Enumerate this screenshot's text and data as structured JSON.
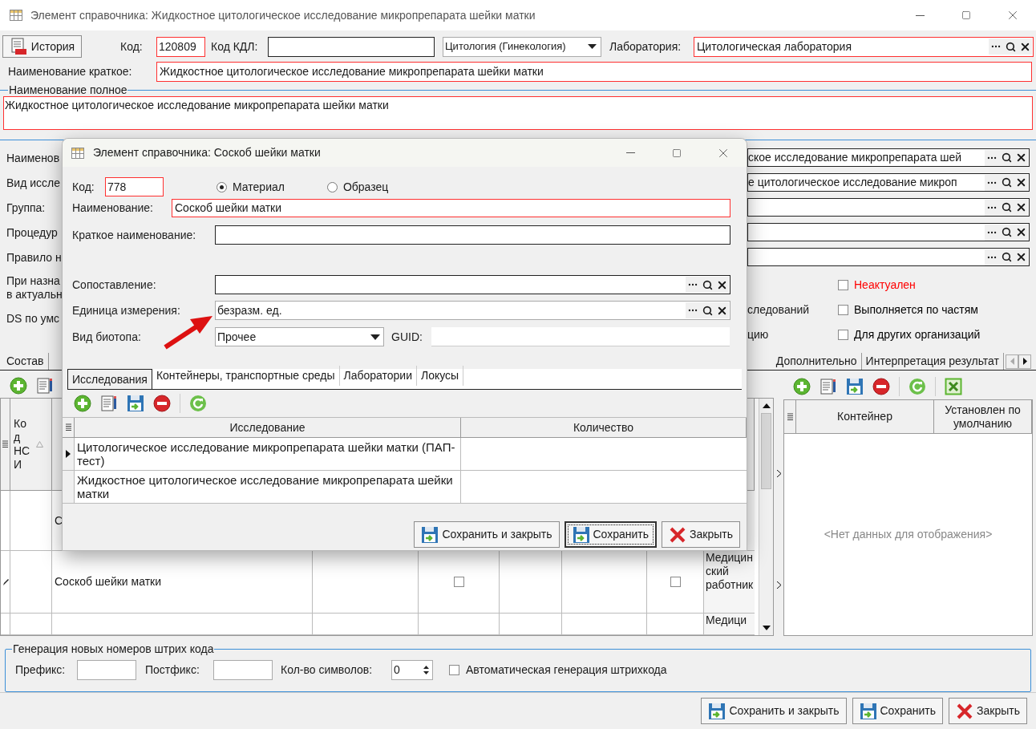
{
  "window": {
    "title": "Элемент справочника: Жидкостное цитологическое исследование микропрепарата шейки матки"
  },
  "history_button": "История",
  "code": {
    "label": "Код:",
    "value": "120809",
    "required": true
  },
  "kdl_code": {
    "label": "Код КДЛ:",
    "required": false
  },
  "category": {
    "value": "Цитология (Гинекология)"
  },
  "laboratory": {
    "label": "Лаборатория:",
    "value": "Цитологическая лаборатория",
    "required": true
  },
  "short_name": {
    "label": "Наименование краткое:",
    "value": "Жидкостное цитологическое исследование микропрепарата шейки матки",
    "required": true
  },
  "full_name": {
    "label": "Наименование полное",
    "value": "Жидкостное цитологическое исследование микропрепарата шейки матки",
    "required": true
  },
  "left_labels": [
    "Наименов",
    "Вид иссле",
    "Группа:",
    "Процедур",
    "Правило н",
    "При назна\nв актуальн",
    "DS по умс"
  ],
  "right_fields": [
    {
      "kind": "lookup",
      "value": "ское исследование микропрепарата шей"
    },
    {
      "kind": "lookup",
      "value": "е цитологическое исследование микроп"
    },
    {
      "kind": "lookup"
    },
    {
      "kind": "lookup"
    },
    {
      "kind": "lookup"
    }
  ],
  "flags": [
    {
      "label": "Неактуален",
      "checked": false,
      "color": "#ff0000"
    },
    {
      "fragment": "следований",
      "label": "Выполняется по частям",
      "checked": false,
      "color": "#000000"
    },
    {
      "fragment": "цию",
      "label": "Для других организаций",
      "checked": false,
      "color": "#000000"
    }
  ],
  "tabs_left": [
    "Состав"
  ],
  "tabs_right": [
    "Дополнительно",
    "Интерпретация результат"
  ],
  "composition_table": {
    "columns": [
      "Код НСИ"
    ],
    "rows": [
      {
        "name": "С",
        "editing": false
      },
      {
        "name": "Соскоб шейки матки",
        "editing": true,
        "flag_a": false,
        "flag_b": false,
        "performer": "Медицинский работник"
      },
      {
        "performer": "Медици",
        "editing": false
      }
    ]
  },
  "containers": {
    "columns": [
      "Контейнер",
      "Установлен по умолчанию"
    ],
    "empty_text": "<Нет данных для отображения>"
  },
  "barcode": {
    "title": "Генерация новых номеров штрих кода",
    "prefix_label": "Префикс:",
    "postfix_label": "Постфикс:",
    "count_label": "Кол-во символов:",
    "count_value": "0",
    "auto": {
      "label": "Автоматическая генерация штрихкода",
      "checked": false
    }
  },
  "buttons": [
    {
      "label": "Сохранить и закрыть",
      "kind": "save"
    },
    {
      "label": "Сохранить",
      "kind": "save"
    },
    {
      "label": "Закрыть",
      "kind": "close"
    }
  ],
  "dialog": {
    "title": "Элемент справочника: Соскоб шейки матки",
    "code": {
      "label": "Код:",
      "value": "778",
      "required": true
    },
    "material_type": [
      {
        "label": "Материал",
        "selected": true
      },
      {
        "label": "Образец",
        "selected": false
      }
    ],
    "name": {
      "label": "Наименование:",
      "value": "Соскоб шейки матки",
      "required": true
    },
    "short_name": {
      "label": "Краткое наименование:",
      "required": false
    },
    "mapping": {
      "label": "Сопоставление:"
    },
    "unit": {
      "label": "Единица измерения:",
      "value": "безразм. ед."
    },
    "biotope": {
      "label": "Вид биотопа:",
      "value": "Прочее"
    },
    "guid": {
      "label": "GUID:"
    },
    "tabs": [
      {
        "label": "Исследования",
        "selected": true
      },
      {
        "label": "Контейнеры, транспортные среды",
        "selected": false
      },
      {
        "label": "Лаборатории",
        "selected": false
      },
      {
        "label": "Локусы",
        "selected": false
      }
    ],
    "table": {
      "columns": [
        "Исследование",
        "Количество"
      ],
      "rows": [
        {
          "name": "Цитологическое исследование микропрепарата шейки матки (ПАП-тест)",
          "current": true
        },
        {
          "name": "Жидкостное цитологическое исследование микропрепарата шейки матки",
          "current": false
        }
      ]
    },
    "buttons": [
      {
        "label": "Сохранить и закрыть",
        "kind": "save",
        "focused": false
      },
      {
        "label": "Сохранить",
        "kind": "save",
        "focused": true
      },
      {
        "label": "Закрыть",
        "kind": "close",
        "focused": false
      }
    ]
  }
}
